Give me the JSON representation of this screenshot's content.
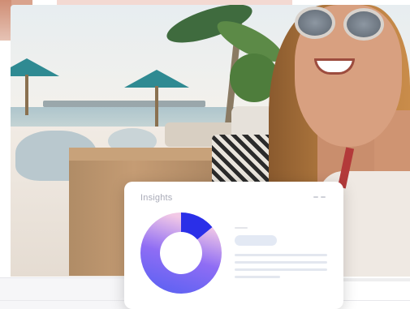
{
  "insights": {
    "title": "Insights",
    "chart_data": {
      "type": "pie",
      "donut": true,
      "values": [
        14,
        86
      ],
      "colors": [
        "#2a2fe8",
        "#6a5cf6"
      ],
      "gradient_end": "#f2c9e6"
    }
  },
  "colors": {
    "accent": "#2a2fe8",
    "card_background": "#ffffff",
    "placeholder": "#e3e7ef"
  }
}
